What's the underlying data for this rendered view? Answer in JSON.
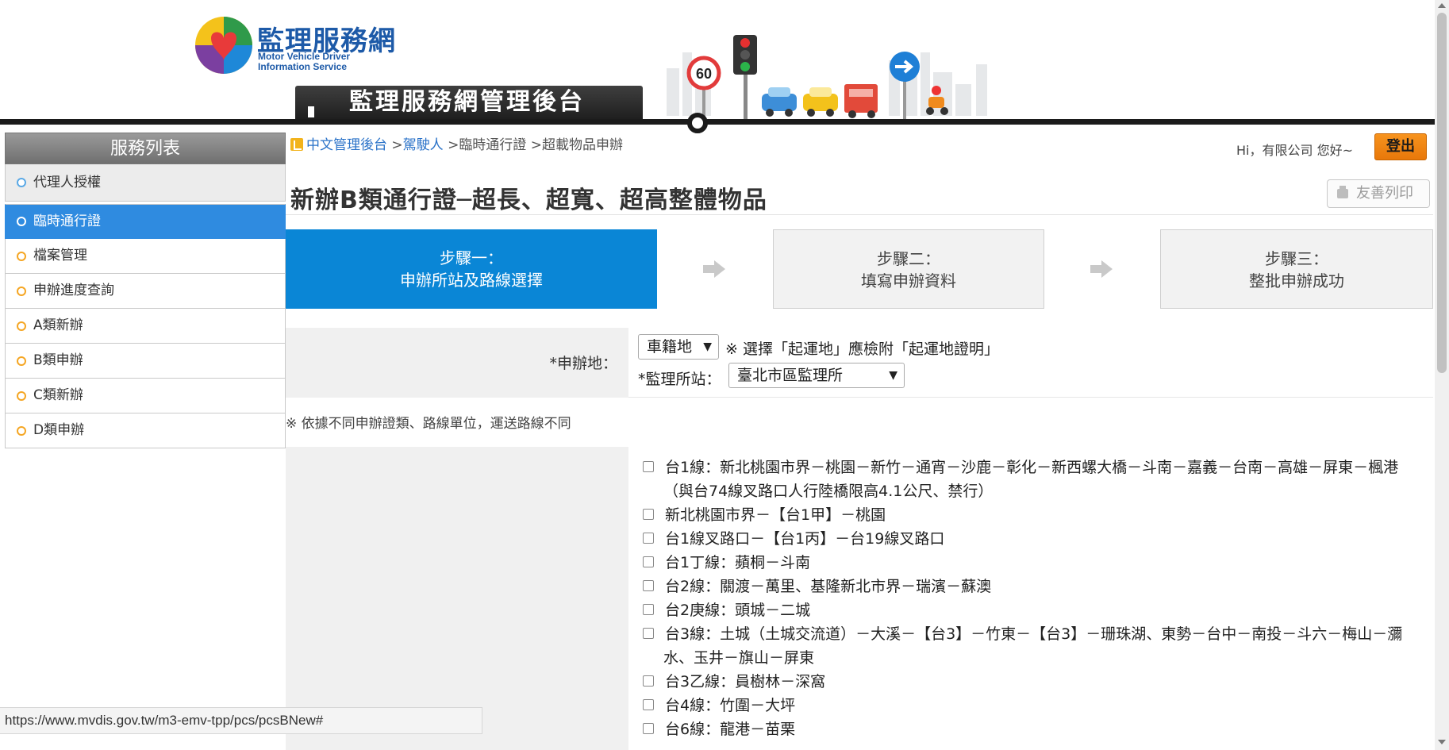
{
  "header": {
    "logo_title": "監理服務網",
    "logo_sub1": "Motor Vehicle Driver",
    "logo_sub2": "Information Service",
    "admin_banner": "監理服務網管理後台"
  },
  "sidebar": {
    "title": "服務列表",
    "items": [
      {
        "label": "代理人授權"
      },
      {
        "label": "臨時通行證"
      },
      {
        "label": "檔案管理"
      },
      {
        "label": "申辦進度查詢"
      },
      {
        "label": "A類新辦"
      },
      {
        "label": "B類申辦"
      },
      {
        "label": "C類新辦"
      },
      {
        "label": "D類申辦"
      }
    ]
  },
  "breadcrumb": {
    "home": "中文管理後台",
    "sep": ">",
    "level1": "駕駛人",
    "level2": "臨時通行證",
    "level3": "超載物品申辦"
  },
  "user": {
    "greeting": "Hi，有限公司 您好~",
    "logout": "登出"
  },
  "page": {
    "title": "新辦B類通行證─超長、超寬、超高整體物品",
    "print": "友善列印"
  },
  "steps": [
    {
      "line1": "步驟一：",
      "line2": "申辦所站及路線選擇"
    },
    {
      "line1": "步驟二：",
      "line2": "填寫申辦資料"
    },
    {
      "line1": "步驟三：",
      "line2": "整批申辦成功"
    }
  ],
  "form": {
    "apply_place_label": "*申辦地：",
    "apply_place_value": "車籍地",
    "apply_place_note": "※ 選擇「起運地」應檢附「起運地證明」",
    "station_label": "*監理所站：",
    "station_value": "臺北市區監理所",
    "caret": "▼",
    "route_note": "※ 依據不同申辦證類、路線單位，運送路線不同"
  },
  "routes": [
    "台1線：新北桃園市界－桃園－新竹－通宵－沙鹿－彰化－新西螺大橋－斗南－嘉義－台南－高雄－屏東－楓港（與台74線叉路口人行陸橋限高4.1公尺、禁行）",
    "新北桃園市界－【台1甲】－桃園",
    "台1線叉路口－【台1丙】－台19線叉路口",
    "台1丁線：蘋桐－斗南",
    "台2線：關渡－萬里、基隆新北市界－瑞濱－蘇澳",
    "台2庚線：頭城－二城",
    "台3線：土城（土城交流道）－大溪－【台3】－竹東－【台3】－珊珠湖、東勢－台中－南投－斗六－梅山－瀰水、玉井－旗山－屏東",
    "台3乙線：員樹林－深窩",
    "台4線：竹圍－大坪",
    "台6線：龍港－苗栗"
  ],
  "status_bar": {
    "url": "https://www.mvdis.gov.tw/m3-emv-tpp/pcs/pcsBNew#"
  },
  "colors": {
    "accent_blue": "#0a86d6",
    "sidebar_active": "#2f8be0",
    "logout_orange": "#f7931e",
    "logo_blue": "#1d5aa8"
  }
}
